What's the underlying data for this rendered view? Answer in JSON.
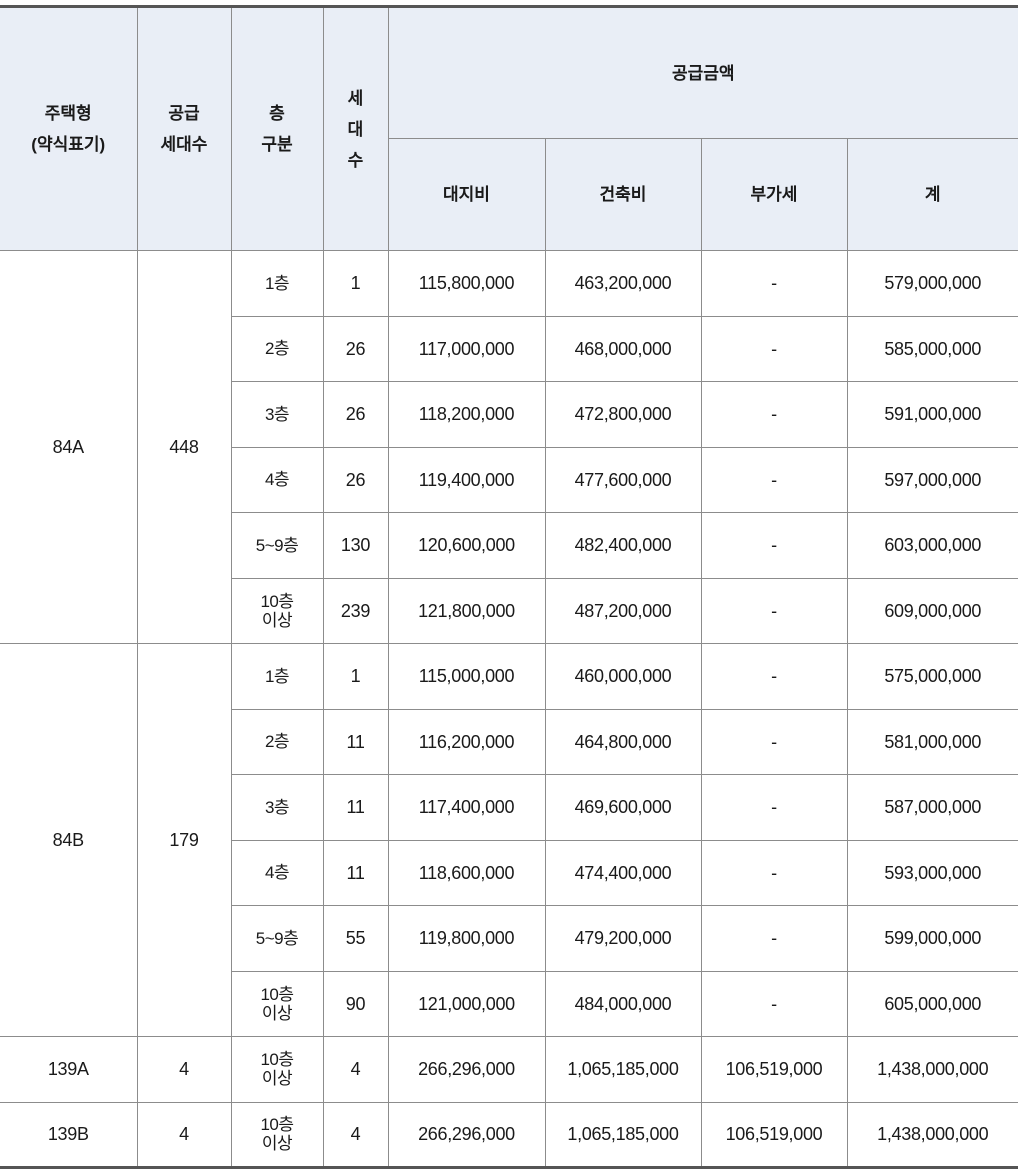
{
  "header": {
    "type_line1": "주택형",
    "type_line2": "(약식표기)",
    "supply_line1": "공급",
    "supply_line2": "세대수",
    "floor_line1": "층",
    "floor_line2": "구분",
    "households_line1": "세",
    "households_line2": "대",
    "households_line3": "수",
    "amount_group": "공급금액",
    "land": "대지비",
    "building": "건축비",
    "vat": "부가세",
    "total": "계"
  },
  "groups": [
    {
      "type": "84A",
      "supply": "448",
      "rows": [
        {
          "floor": "1층",
          "households": "1",
          "land": "115,800,000",
          "building": "463,200,000",
          "vat": "-",
          "total": "579,000,000"
        },
        {
          "floor": "2층",
          "households": "26",
          "land": "117,000,000",
          "building": "468,000,000",
          "vat": "-",
          "total": "585,000,000"
        },
        {
          "floor": "3층",
          "households": "26",
          "land": "118,200,000",
          "building": "472,800,000",
          "vat": "-",
          "total": "591,000,000"
        },
        {
          "floor": "4층",
          "households": "26",
          "land": "119,400,000",
          "building": "477,600,000",
          "vat": "-",
          "total": "597,000,000"
        },
        {
          "floor": "5~9층",
          "households": "130",
          "land": "120,600,000",
          "building": "482,400,000",
          "vat": "-",
          "total": "603,000,000"
        },
        {
          "floor": "10층 이상",
          "floor_l1": "10층",
          "floor_l2": "이상",
          "households": "239",
          "land": "121,800,000",
          "building": "487,200,000",
          "vat": "-",
          "total": "609,000,000"
        }
      ]
    },
    {
      "type": "84B",
      "supply": "179",
      "rows": [
        {
          "floor": "1층",
          "households": "1",
          "land": "115,000,000",
          "building": "460,000,000",
          "vat": "-",
          "total": "575,000,000"
        },
        {
          "floor": "2층",
          "households": "11",
          "land": "116,200,000",
          "building": "464,800,000",
          "vat": "-",
          "total": "581,000,000"
        },
        {
          "floor": "3층",
          "households": "11",
          "land": "117,400,000",
          "building": "469,600,000",
          "vat": "-",
          "total": "587,000,000"
        },
        {
          "floor": "4층",
          "households": "11",
          "land": "118,600,000",
          "building": "474,400,000",
          "vat": "-",
          "total": "593,000,000"
        },
        {
          "floor": "5~9층",
          "households": "55",
          "land": "119,800,000",
          "building": "479,200,000",
          "vat": "-",
          "total": "599,000,000"
        },
        {
          "floor": "10층 이상",
          "floor_l1": "10층",
          "floor_l2": "이상",
          "households": "90",
          "land": "121,000,000",
          "building": "484,000,000",
          "vat": "-",
          "total": "605,000,000"
        }
      ]
    },
    {
      "type": "139A",
      "supply": "4",
      "rows": [
        {
          "floor": "10층 이상",
          "floor_l1": "10층",
          "floor_l2": "이상",
          "households": "4",
          "land": "266,296,000",
          "building": "1,065,185,000",
          "vat": "106,519,000",
          "total": "1,438,000,000"
        }
      ]
    },
    {
      "type": "139B",
      "supply": "4",
      "rows": [
        {
          "floor": "10층 이상",
          "floor_l1": "10층",
          "floor_l2": "이상",
          "households": "4",
          "land": "266,296,000",
          "building": "1,065,185,000",
          "vat": "106,519,000",
          "total": "1,438,000,000"
        }
      ]
    }
  ]
}
